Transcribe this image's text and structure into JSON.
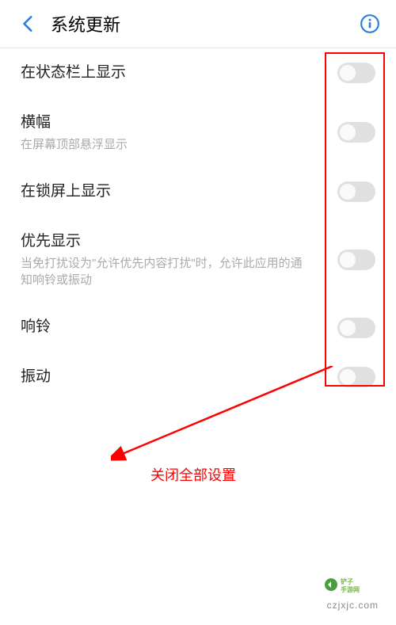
{
  "header": {
    "title": "系统更新"
  },
  "settings": [
    {
      "label": "在状态栏上显示",
      "desc": "",
      "on": false
    },
    {
      "label": "横幅",
      "desc": "在屏幕顶部悬浮显示",
      "on": false
    },
    {
      "label": "在锁屏上显示",
      "desc": "",
      "on": false
    },
    {
      "label": "优先显示",
      "desc": "当免打扰设为\"允许优先内容打扰\"时，允许此应用的通知响铃或振动",
      "on": false
    },
    {
      "label": "响铃",
      "desc": "",
      "on": false
    },
    {
      "label": "振动",
      "desc": "",
      "on": false
    }
  ],
  "annotation": {
    "text": "关闭全部设置"
  },
  "watermark": {
    "url": "czjxjc.com"
  }
}
